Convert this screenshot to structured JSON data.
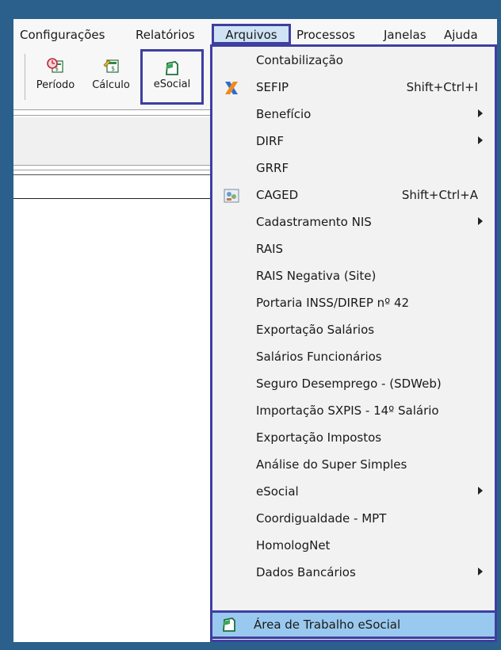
{
  "menubar": {
    "items": [
      "Configurações",
      "Relatórios",
      "Arquivos",
      "Processos",
      "Janelas",
      "Ajuda"
    ]
  },
  "toolbar": {
    "buttons": [
      {
        "label": "Período",
        "icon": "calendar-clock-icon"
      },
      {
        "label": "Cálculo",
        "icon": "calculator-icon"
      },
      {
        "label": "eSocial",
        "icon": "esocial-icon"
      }
    ]
  },
  "dropdown": {
    "items": [
      {
        "label": "Contabilização"
      },
      {
        "label": "SEFIP",
        "shortcut": "Shift+Ctrl+I",
        "icon": "sefip-x-icon"
      },
      {
        "label": "Benefício",
        "submenu": true
      },
      {
        "label": "DIRF",
        "submenu": true
      },
      {
        "label": "GRRF"
      },
      {
        "label": "CAGED",
        "shortcut": "Shift+Ctrl+A",
        "icon": "caged-icon"
      },
      {
        "label": "Cadastramento NIS",
        "submenu": true
      },
      {
        "label": "RAIS"
      },
      {
        "label": "RAIS Negativa (Site)"
      },
      {
        "label": "Portaria INSS/DIREP nº 42"
      },
      {
        "label": "Exportação Salários"
      },
      {
        "label": "Salários Funcionários"
      },
      {
        "label": "Seguro Desemprego - (SDWeb)"
      },
      {
        "label": "Importação SXPIS - 14º Salário"
      },
      {
        "label": "Exportação Impostos"
      },
      {
        "label": "Análise do Super Simples"
      },
      {
        "label": "eSocial",
        "submenu": true
      },
      {
        "label": "Coordigualdade - MPT"
      },
      {
        "label": "HomologNet"
      },
      {
        "label": "Dados Bancários",
        "submenu": true
      }
    ],
    "highlighted": {
      "label": "Área de Trabalho eSocial",
      "icon": "esocial-icon"
    }
  },
  "colors": {
    "frame": "#2b5f8c",
    "highlight_border": "#3e3fa0",
    "selected_item": "#99c9ef"
  }
}
